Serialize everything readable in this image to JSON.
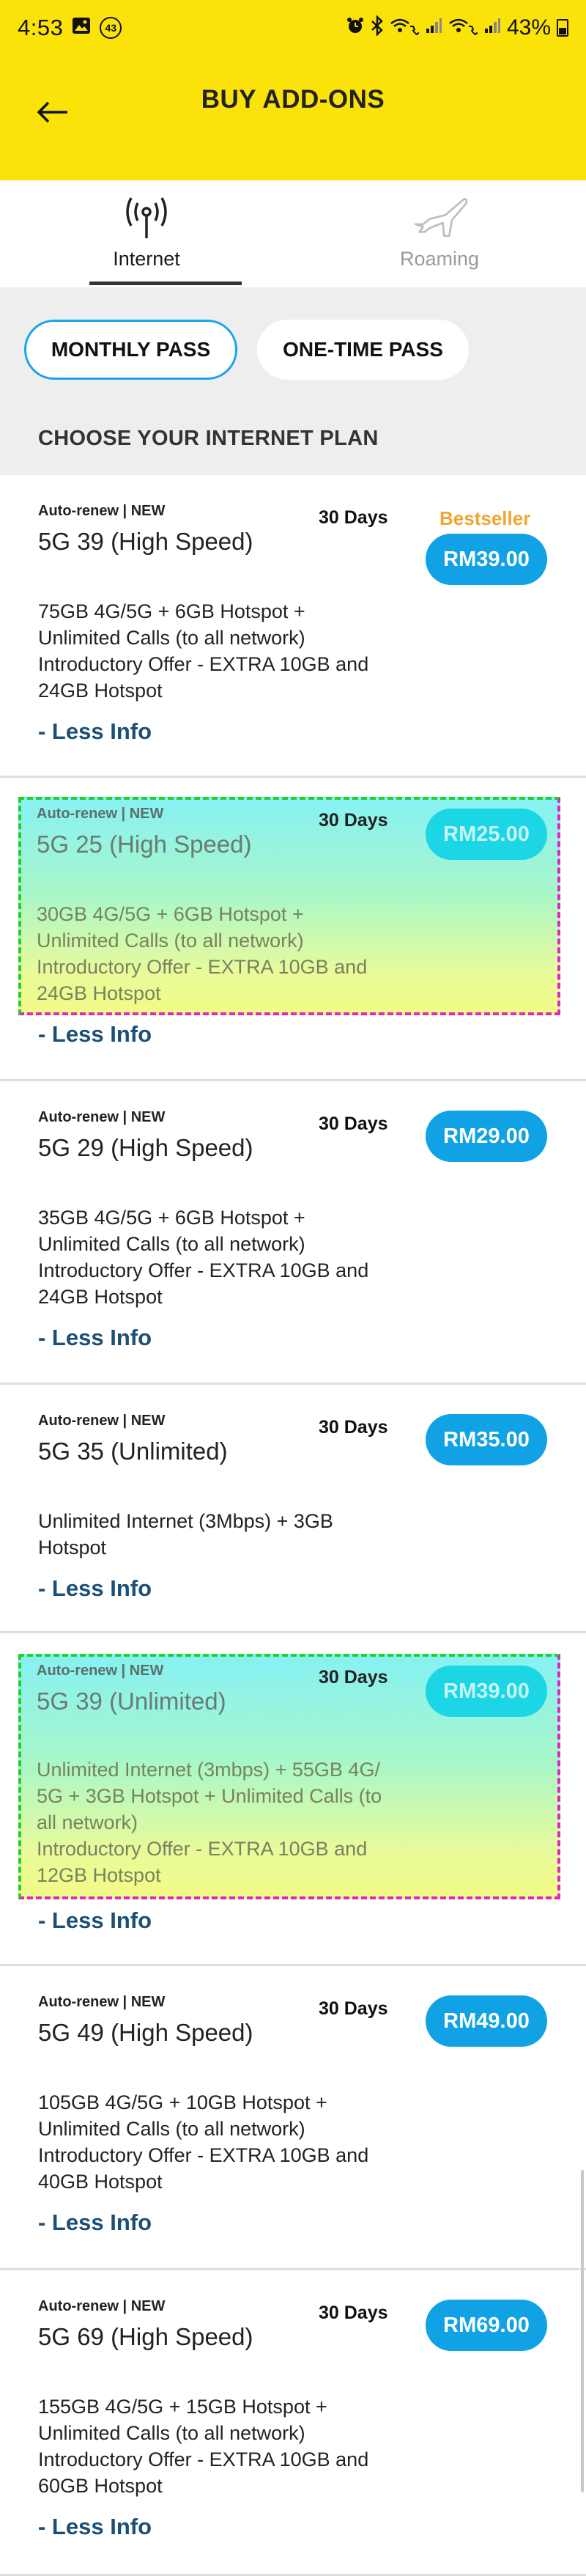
{
  "status_bar": {
    "time": "4:53",
    "notification_count": "43",
    "battery_percent": "43%"
  },
  "header": {
    "title": "BUY ADD-ONS",
    "background": "#fbe30a"
  },
  "tabs": [
    {
      "label": "Internet",
      "icon": "antenna-icon",
      "selected": true
    },
    {
      "label": "Roaming",
      "icon": "airplane-icon",
      "selected": false
    }
  ],
  "pass_types": [
    {
      "label": "MONTHLY PASS",
      "selected": true
    },
    {
      "label": "ONE-TIME PASS",
      "selected": false
    }
  ],
  "section_title": "CHOOSE YOUR INTERNET PLAN",
  "accent_color": "#11a2e6",
  "plans": [
    {
      "tag": "Auto-renew | NEW",
      "name": "5G 39 (High Speed)",
      "days": "30 Days",
      "badge": "Bestseller",
      "price": "RM39.00",
      "description": "75GB 4G/5G + 6GB Hotspot +\nUnlimited Calls (to all network)\nIntroductory Offer - EXTRA 10GB and\n24GB Hotspot",
      "less_info": "- Less Info"
    },
    {
      "tag": "Auto-renew | NEW",
      "name": "5G 25 (High Speed)",
      "days": "30 Days",
      "price": "RM25.00",
      "description": "30GB 4G/5G + 6GB Hotspot +\nUnlimited Calls (to all network)\nIntroductory Offer - EXTRA 10GB and\n24GB Hotspot",
      "less_info": "- Less Info"
    },
    {
      "tag": "Auto-renew | NEW",
      "name": "5G 29 (High Speed)",
      "days": "30 Days",
      "price": "RM29.00",
      "description": "35GB 4G/5G + 6GB Hotspot +\nUnlimited Calls (to all network)\nIntroductory Offer - EXTRA 10GB and\n24GB Hotspot",
      "less_info": "- Less Info"
    },
    {
      "tag": "Auto-renew | NEW",
      "name": "5G 35 (Unlimited)",
      "days": "30 Days",
      "price": "RM35.00",
      "description": "Unlimited Internet (3Mbps) + 3GB\nHotspot",
      "less_info": "- Less Info"
    },
    {
      "tag": "Auto-renew | NEW",
      "name": "5G 39 (Unlimited)",
      "days": "30 Days",
      "price": "RM39.00",
      "description": "Unlimited Internet (3mbps) + 55GB 4G/\n5G + 3GB Hotspot + Unlimited Calls (to\nall network)\nIntroductory Offer - EXTRA 10GB and\n12GB Hotspot",
      "less_info": "- Less Info"
    },
    {
      "tag": "Auto-renew | NEW",
      "name": "5G 49 (High Speed)",
      "days": "30 Days",
      "price": "RM49.00",
      "description": "105GB 4G/5G + 10GB Hotspot +\nUnlimited Calls (to all network)\nIntroductory Offer - EXTRA 10GB and\n40GB Hotspot",
      "less_info": "- Less Info"
    },
    {
      "tag": "Auto-renew | NEW",
      "name": "5G 69 (High Speed)",
      "days": "30 Days",
      "price": "RM69.00",
      "description": "155GB 4G/5G + 15GB Hotspot +\nUnlimited Calls (to all network)\nIntroductory Offer - EXTRA 10GB and\n60GB Hotspot",
      "less_info": "- Less Info"
    }
  ]
}
